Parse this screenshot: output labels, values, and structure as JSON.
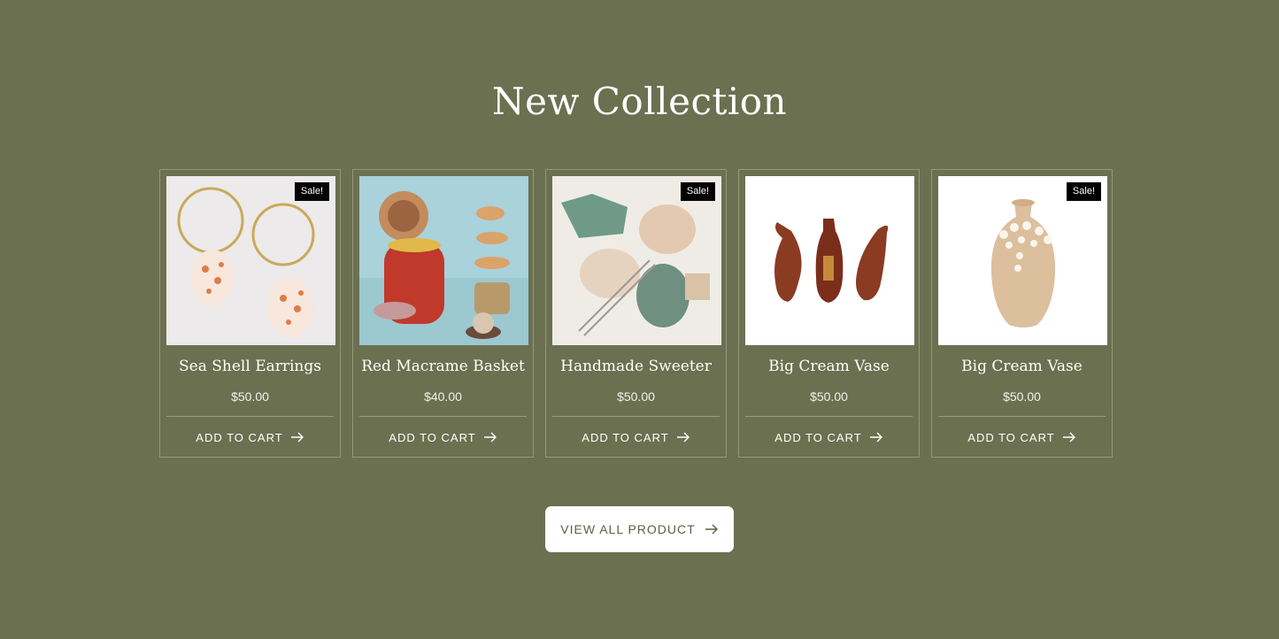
{
  "section": {
    "title": "New Collection",
    "view_all_label": "VIEW ALL PRODUCT"
  },
  "colors": {
    "background": "#6b7050",
    "card_border": "#8b8f74",
    "sale_badge": "#000000",
    "button_text": "#5d6244"
  },
  "products": [
    {
      "name": "Sea Shell Earrings",
      "price": "$50.00",
      "badge": "Sale!",
      "cart_label": "ADD TO CART",
      "image": "sea-shell-earrings-photo"
    },
    {
      "name": "Red Macrame Basket",
      "price": "$40.00",
      "badge": "",
      "cart_label": "ADD TO CART",
      "image": "red-macrame-basket-photo"
    },
    {
      "name": "Handmade Sweeter",
      "price": "$50.00",
      "badge": "Sale!",
      "cart_label": "ADD TO CART",
      "image": "yarn-knitting-photo"
    },
    {
      "name": "Big Cream Vase",
      "price": "$50.00",
      "badge": "",
      "cart_label": "ADD TO CART",
      "image": "three-ceramic-vases-photo"
    },
    {
      "name": "Big Cream Vase",
      "price": "$50.00",
      "badge": "Sale!",
      "cart_label": "ADD TO CART",
      "image": "cream-flower-vase-photo"
    }
  ]
}
